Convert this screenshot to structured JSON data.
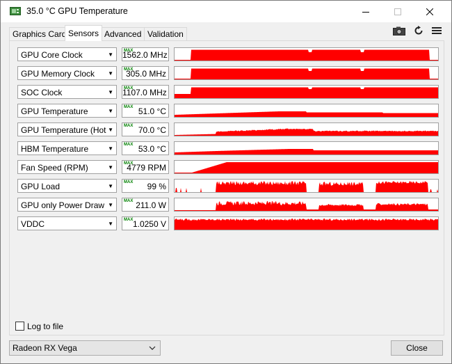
{
  "window": {
    "title": "35.0 °C GPU Temperature",
    "minimize_glyph": "—",
    "maximize_glyph": "☐",
    "close_glyph": "✕"
  },
  "tabs": [
    {
      "label": "Graphics Card",
      "active": false
    },
    {
      "label": "Sensors",
      "active": true
    },
    {
      "label": "Advanced",
      "active": false
    },
    {
      "label": "Validation",
      "active": false
    }
  ],
  "toolbar": {
    "camera_icon": "camera-icon",
    "refresh_icon": "refresh-icon",
    "menu_icon": "hamburger-menu-icon"
  },
  "max_tag": "MAX",
  "graph_color": "#ff0000",
  "sensors": [
    {
      "name": "GPU Core Clock",
      "value": "1562.0 MHz",
      "shape": "clock"
    },
    {
      "name": "GPU Memory Clock",
      "value": "305.0 MHz",
      "shape": "clock"
    },
    {
      "name": "SOC Clock",
      "value": "1107.0 MHz",
      "shape": "soc"
    },
    {
      "name": "GPU Temperature",
      "value": "51.0 °C",
      "shape": "temp"
    },
    {
      "name": "GPU Temperature (Hot Spot)",
      "value": "70.0 °C",
      "shape": "hotspot"
    },
    {
      "name": "HBM Temperature",
      "value": "53.0 °C",
      "shape": "hbm"
    },
    {
      "name": "Fan Speed (RPM)",
      "value": "4779 RPM",
      "shape": "fan"
    },
    {
      "name": "GPU Load",
      "value": "99 %",
      "shape": "load"
    },
    {
      "name": "GPU only Power Draw",
      "value": "211.0 W",
      "shape": "power"
    },
    {
      "name": "VDDC",
      "value": "1.0250 V",
      "shape": "vddc"
    }
  ],
  "log_to_file": {
    "label": "Log to file",
    "checked": false
  },
  "gpu_select": {
    "value": "Radeon RX Vega"
  },
  "close_button": {
    "label": "Close"
  }
}
